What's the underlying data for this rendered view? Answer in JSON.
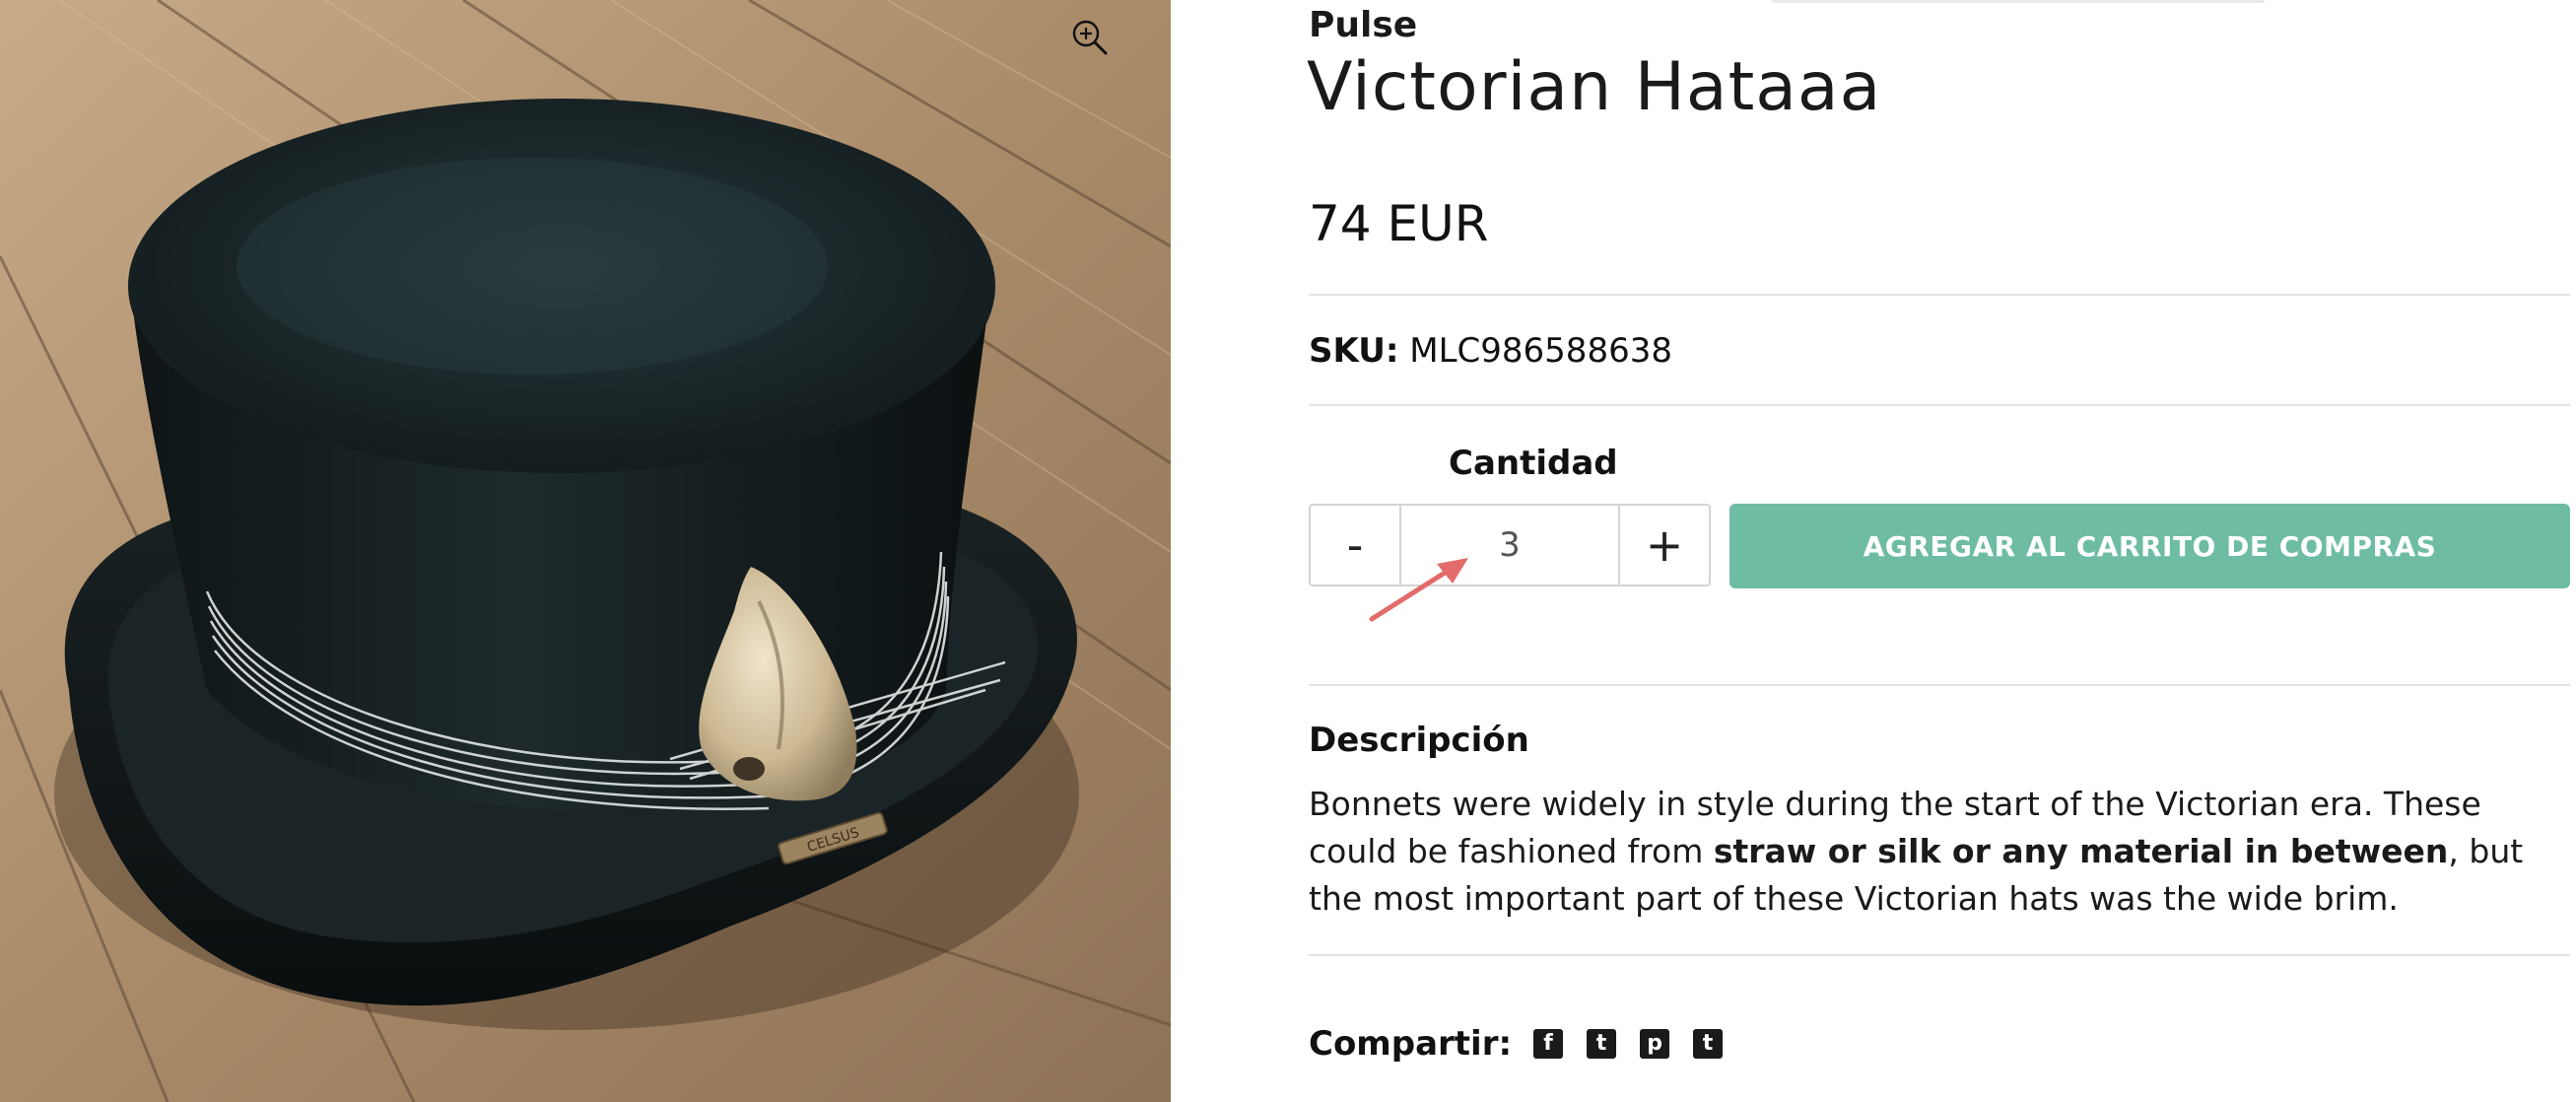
{
  "product": {
    "vendor": "Pulse",
    "title": "Victorian Hataaa",
    "price": "74 EUR",
    "sku_label": "SKU:",
    "sku_value": "MLC986588638"
  },
  "quantity": {
    "label": "Cantidad",
    "minus_label": "-",
    "plus_label": "+",
    "value": "3"
  },
  "cart": {
    "add_label": "AGREGAR AL CARRITO DE COMPRAS",
    "color": "#6dbca3"
  },
  "description": {
    "heading": "Descripción",
    "text_before": "Bonnets were widely in style during the start of the Victorian era. These could be fashioned from ",
    "text_bold": "straw or silk or any material in between",
    "text_after": ", but the most important part of these Victorian hats was the wide brim."
  },
  "share": {
    "label": "Compartir:",
    "icons": [
      "facebook-icon",
      "twitter-icon",
      "pinterest-icon",
      "tumblr-icon"
    ],
    "glyphs": [
      "f",
      "t",
      "p",
      "t"
    ]
  },
  "image": {
    "zoom_icon": "zoom-in-icon",
    "badge_text": "CELSUS"
  },
  "annotation": {
    "arrow_color": "#e36b6b"
  }
}
